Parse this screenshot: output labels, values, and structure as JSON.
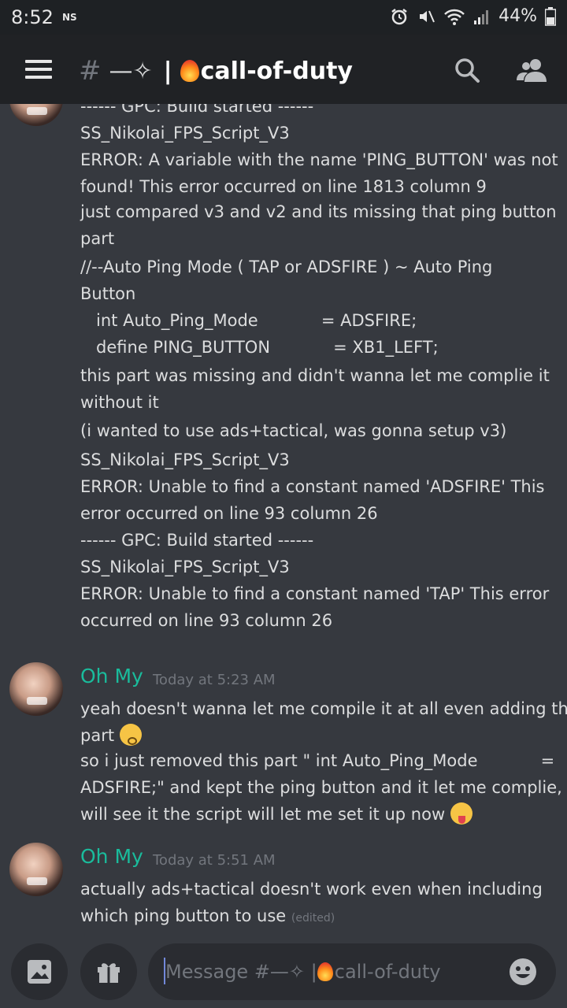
{
  "status_bar": {
    "time": "8:52",
    "carrier": "NS",
    "battery": "44%"
  },
  "header": {
    "hash": "#",
    "channel_deco": "—✧",
    "separator": "|",
    "channel_name": "call-of-duty"
  },
  "messages": {
    "continued_lines": [
      "------ GPC: Build started ------",
      "SS_Nikolai_FPS_Script_V3",
      "ERROR: A variable with the name 'PING_BUTTON' was not",
      "found! This error occurred on line 1813 column 9",
      "just compared v3 and v2 and its missing that ping button",
      "part",
      "//--Auto Ping Mode ( TAP or ADSFIRE ) ~ Auto Ping",
      "Button",
      "   int Auto_Ping_Mode            = ADSFIRE;",
      "   define PING_BUTTON            = XB1_LEFT;",
      "this part was missing and didn't wanna let me complie it",
      "without it",
      "(i wanted to use ads+tactical, was gonna setup v3)",
      "SS_Nikolai_FPS_Script_V3",
      "ERROR: Unable to find a constant named 'ADSFIRE' This",
      "error occurred on line 93 column 26",
      "------ GPC: Build started ------",
      "SS_Nikolai_FPS_Script_V3",
      "ERROR: Unable to find a constant named 'TAP' This error",
      "occurred on line 93 column 26"
    ],
    "group2": {
      "author": "Oh My",
      "time": "Today at 5:23 AM",
      "line1": "yeah doesn't wanna let me compile it at all even adding that",
      "line2": "part",
      "line3": "so i just removed this part \" int Auto_Ping_Mode            =",
      "line4": "ADSFIRE;\" and kept the ping button and it let me complie,",
      "line5": "will see it the script will let me set it up now"
    },
    "group3": {
      "author": "Oh My",
      "time": "Today at 5:51 AM",
      "line1": "actually ads+tactical doesn't work even when including",
      "line2": "which ping button to use",
      "edited": "(edited)"
    }
  },
  "composer": {
    "placeholder_prefix": "Message #—✧ | ",
    "placeholder_channel": "call-of-duty"
  },
  "colors": {
    "author": "#1abc9c",
    "background": "#36393f",
    "header": "#202225"
  }
}
